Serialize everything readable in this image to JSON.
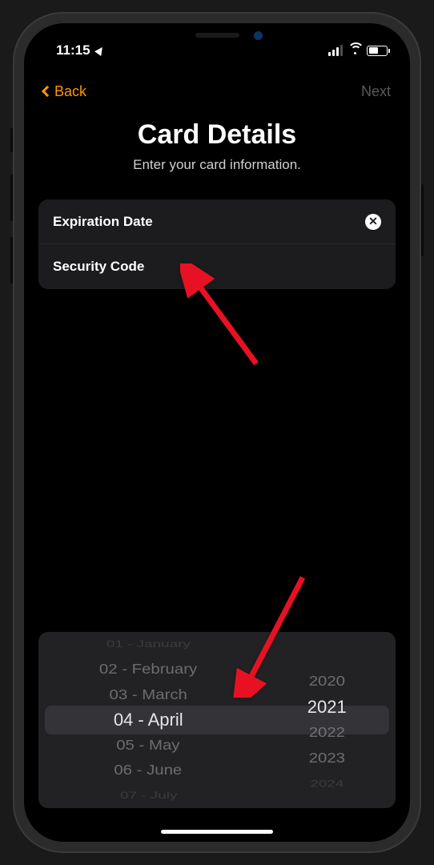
{
  "status": {
    "time": "11:15"
  },
  "nav": {
    "back_label": "Back",
    "next_label": "Next"
  },
  "header": {
    "title": "Card Details",
    "subtitle": "Enter your card information."
  },
  "form": {
    "expiration_label": "Expiration Date",
    "security_label": "Security Code"
  },
  "picker": {
    "months": [
      "01 - January",
      "02 - February",
      "03 - March",
      "04 - April",
      "05 - May",
      "06 - June",
      "07 - July"
    ],
    "years": [
      "2020",
      "2021",
      "2022",
      "2023",
      "2024"
    ],
    "selected_month": "04 - April",
    "selected_year": "2021"
  }
}
